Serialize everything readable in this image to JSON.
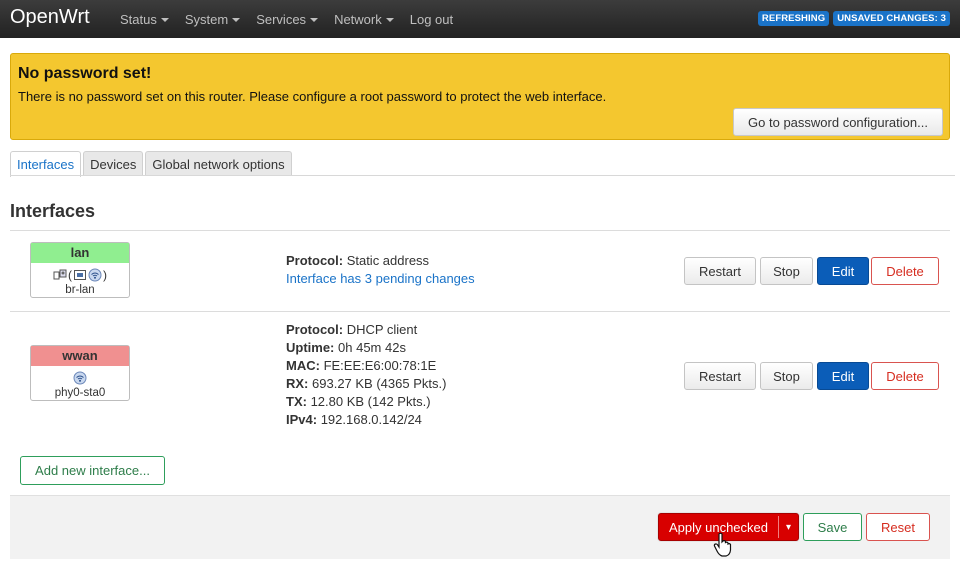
{
  "nav": {
    "brand": "OpenWrt",
    "menu": [
      {
        "label": "Status",
        "dropdown": true
      },
      {
        "label": "System",
        "dropdown": true
      },
      {
        "label": "Services",
        "dropdown": true
      },
      {
        "label": "Network",
        "dropdown": true
      },
      {
        "label": "Log out",
        "dropdown": false
      }
    ],
    "badges": [
      "REFRESHING",
      "UNSAVED CHANGES: 3"
    ]
  },
  "alert": {
    "title": "No password set!",
    "text": "There is no password set on this router. Please configure a root password to protect the web interface.",
    "button": "Go to password configuration..."
  },
  "tabs": {
    "interfaces": "Interfaces",
    "devices": "Devices",
    "global": "Global network options"
  },
  "section_title": "Interfaces",
  "interfaces": [
    {
      "name": "lan",
      "device": "br-lan",
      "color": "#90ee90",
      "info": [
        {
          "label": "Protocol:",
          "value": "Static address"
        }
      ],
      "pending": "Interface has 3 pending changes"
    },
    {
      "name": "wwan",
      "device": "phy0-sta0",
      "color": "#f09090",
      "info": [
        {
          "label": "Protocol:",
          "value": "DHCP client"
        },
        {
          "label": "Uptime:",
          "value": "0h 45m 42s"
        },
        {
          "label": "MAC:",
          "value": "FE:EE:E6:00:78:1E"
        },
        {
          "label": "RX:",
          "value": "693.27 KB (4365 Pkts.)"
        },
        {
          "label": "TX:",
          "value": "12.80 KB (142 Pkts.)"
        },
        {
          "label": "IPv4:",
          "value": "192.168.0.142/24"
        }
      ]
    }
  ],
  "row_buttons": {
    "restart": "Restart",
    "stop": "Stop",
    "edit": "Edit",
    "delete": "Delete"
  },
  "add_interface": "Add new interface...",
  "footer": {
    "apply": "Apply unchecked",
    "apply_drop": "▾",
    "save": "Save",
    "reset": "Reset"
  },
  "colors": {
    "accent": "#1a73c8",
    "edit": "#0b5db8",
    "danger": "#d80000",
    "warning": "#f4c72f"
  }
}
